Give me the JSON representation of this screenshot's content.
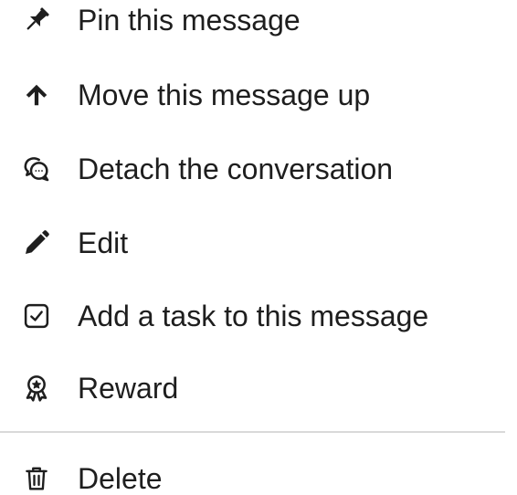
{
  "menu": {
    "items": [
      {
        "label": "Pin this message",
        "icon": "pin-icon"
      },
      {
        "label": "Move this message up",
        "icon": "arrow-up-icon"
      },
      {
        "label": "Detach the conversation",
        "icon": "chat-bubbles-icon"
      },
      {
        "label": "Edit",
        "icon": "pencil-icon"
      },
      {
        "label": "Add a task to this message",
        "icon": "checkbox-icon"
      },
      {
        "label": "Reward",
        "icon": "award-icon"
      },
      {
        "label": "Delete",
        "icon": "trash-icon"
      }
    ]
  },
  "colors": {
    "text": "#1e1e1e",
    "divider": "#d9d9d9",
    "background": "#ffffff"
  }
}
